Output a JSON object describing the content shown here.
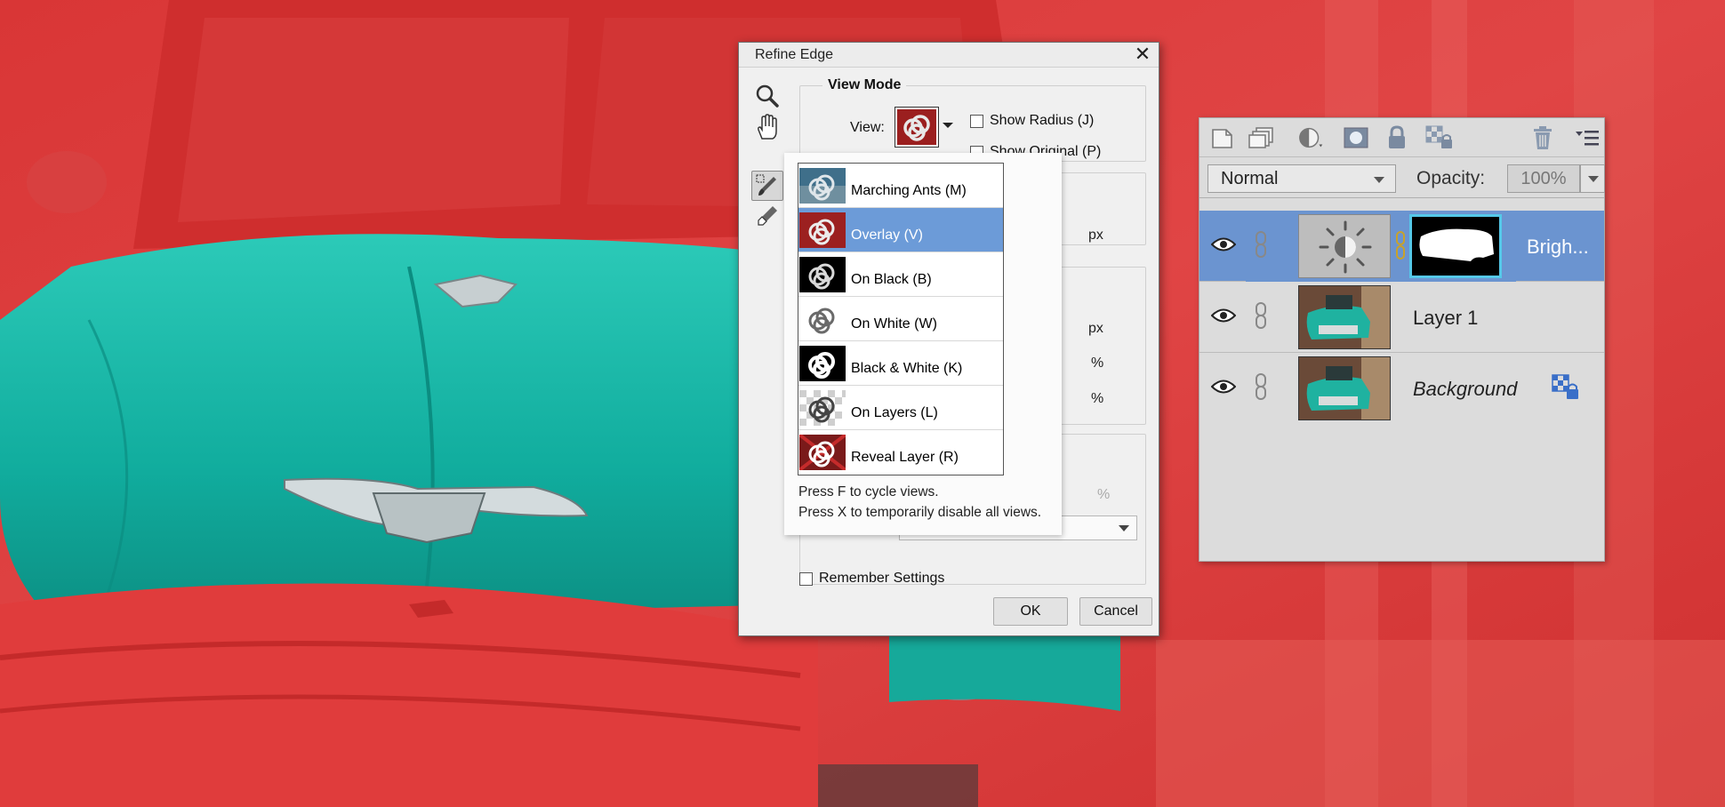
{
  "dialog": {
    "title": "Refine Edge",
    "close_glyph": "✕",
    "view_mode": {
      "legend": "View Mode",
      "view_label": "View:",
      "show_radius": "Show Radius (J)",
      "show_original": "Show Original (P)"
    },
    "units": {
      "radius": "px",
      "smooth": "px",
      "feather": "%",
      "contrast": "%",
      "decontam": "%"
    },
    "remember_settings": "Remember Settings",
    "ok": "OK",
    "cancel": "Cancel"
  },
  "view_popup": {
    "items": [
      {
        "label": "Marching Ants (M)",
        "thumb": "marching-ants",
        "selected": false
      },
      {
        "label": "Overlay (V)",
        "thumb": "overlay",
        "selected": true
      },
      {
        "label": "On Black (B)",
        "thumb": "on-black",
        "selected": false
      },
      {
        "label": "On White (W)",
        "thumb": "on-white",
        "selected": false
      },
      {
        "label": "Black & White (K)",
        "thumb": "black-white",
        "selected": false
      },
      {
        "label": "On Layers (L)",
        "thumb": "on-layers",
        "selected": false
      },
      {
        "label": "Reveal Layer (R)",
        "thumb": "reveal-layer",
        "selected": false
      }
    ],
    "hint_1": "Press F to cycle views.",
    "hint_2": "Press X to temporarily disable all views."
  },
  "layers_panel": {
    "blend_mode": "Normal",
    "opacity_label": "Opacity:",
    "opacity_value": "100%",
    "layers": [
      {
        "name": "Brigh...",
        "type": "adjustment",
        "active": true
      },
      {
        "name": "Layer 1",
        "type": "pixel",
        "active": false
      },
      {
        "name": "Background",
        "type": "background",
        "active": false,
        "locked": true
      }
    ]
  },
  "colors": {
    "overlay_red": "#e03a3a",
    "car_teal": "#17b7a7",
    "selection_blue": "#6c9bd8",
    "layer_active": "#6b94d0"
  }
}
